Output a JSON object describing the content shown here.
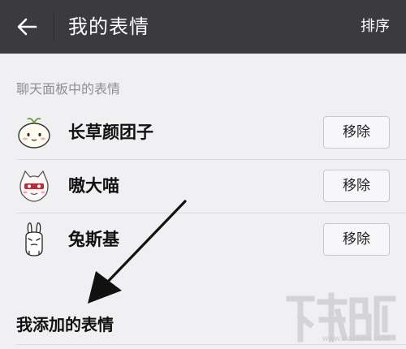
{
  "header": {
    "title": "我的表情",
    "sort_label": "排序",
    "back_icon": "arrow-left-icon"
  },
  "chat_panel_section": {
    "label": "聊天面板中的表情",
    "items": [
      {
        "name": "长草颜团子",
        "remove_label": "移除",
        "icon": "dango-sticker-icon"
      },
      {
        "name": "嗷大喵",
        "remove_label": "移除",
        "icon": "cat-sticker-icon"
      },
      {
        "name": "兔斯基",
        "remove_label": "移除",
        "icon": "rabbit-sticker-icon"
      }
    ]
  },
  "my_added_section": {
    "label": "我添加的表情"
  },
  "watermark": {
    "site": "www.xiazaiba.com"
  },
  "colors": {
    "header_bg": "#3b3b3f",
    "page_bg": "#f0f0f2",
    "button_border": "#c8c8cc"
  }
}
